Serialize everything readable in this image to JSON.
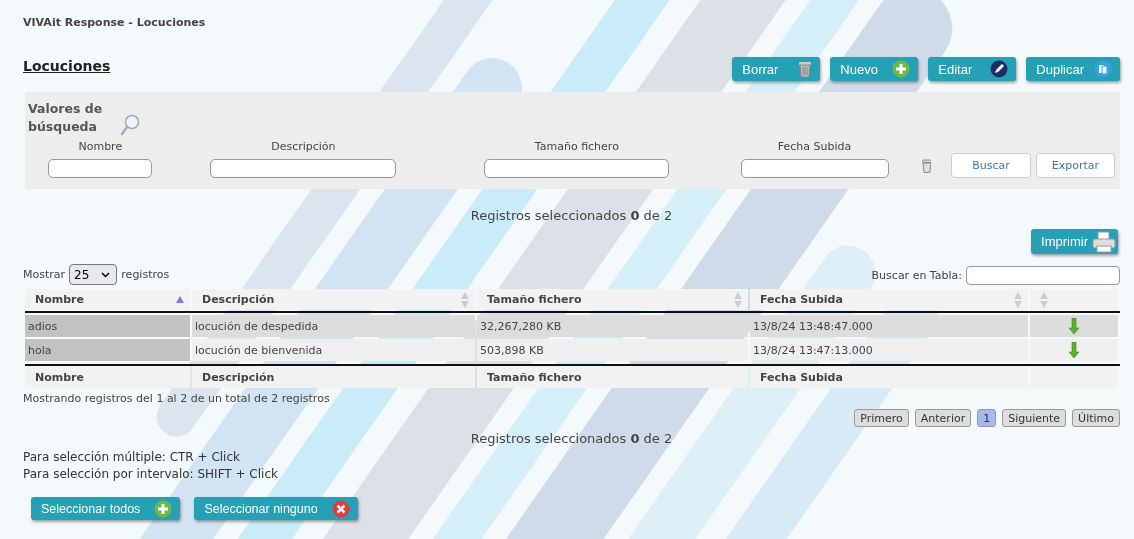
{
  "window": {
    "title": "VIVAit Response - Locuciones"
  },
  "page": {
    "heading": "Locuciones"
  },
  "toolbar": [
    {
      "label": "Borrar"
    },
    {
      "label": "Nuevo"
    },
    {
      "label": "Editar"
    },
    {
      "label": "Duplicar"
    }
  ],
  "search_panel": {
    "title": "Valores de búsqueda",
    "fields": [
      {
        "label": "Nombre"
      },
      {
        "label": "Descripción"
      },
      {
        "label": "Tamaño fichero"
      },
      {
        "label": "Fecha Subida"
      }
    ],
    "buttons": [
      "Buscar",
      "Exportar"
    ]
  },
  "selection_count_top": "Registros seleccionados **0** de 2",
  "print_button": "Imprimir",
  "length_menu": {
    "prefix": "Mostrar",
    "value": "25",
    "suffix": "registros"
  },
  "table_search": {
    "label": "Buscar en Tabla:"
  },
  "table": {
    "columns": [
      {
        "label": "Nombre",
        "sorted_ascending": true
      },
      {
        "label": "Descripción",
        "sorted_ascending": false
      },
      {
        "label": "Tamaño fichero",
        "sorted_ascending": false
      },
      {
        "label": "Fecha Subida",
        "sorted_ascending": false
      },
      {
        "sorted_ascending": false
      }
    ],
    "rows": [
      {
        "cells": [
          "adios",
          "locución de despedida",
          "32,267,280 KB",
          "13/8/24 13:48:47.000"
        ]
      },
      {
        "cells": [
          "hola",
          "locución de bienvenida",
          "503,898 KB",
          "13/8/24 13:47:13.000"
        ]
      }
    ],
    "footer_columns": [
      "Nombre",
      "Descripción",
      "Tamaño fichero",
      "Fecha Subida"
    ]
  },
  "table_info": "Mostrando registros del 1 al 2 de un total de 2 registros",
  "pagination": [
    {
      "label": "Primero",
      "selected": false
    },
    {
      "label": "Anterior",
      "selected": false
    },
    {
      "label": "1",
      "selected": true
    },
    {
      "label": "Siguiente",
      "selected": false
    },
    {
      "label": "Último",
      "selected": false
    }
  ],
  "selection_count_bottom": "Registros seleccionados **0** de 2",
  "hints": [
    "Para selección múltiple: CTR + Click",
    "Para selección por intervalo: SHIFT + Click"
  ],
  "selection_buttons": [
    {
      "label": "Seleccionar todos"
    },
    {
      "label": "Seleccionar ninguno"
    }
  ]
}
